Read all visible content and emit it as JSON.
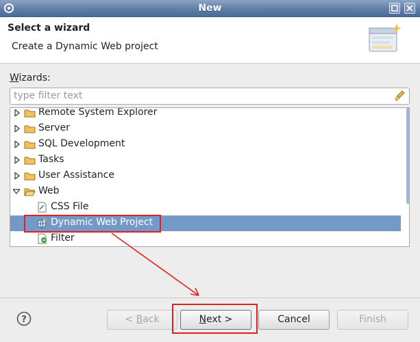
{
  "window": {
    "title": "New"
  },
  "header": {
    "title": "Select a wizard",
    "description": "Create a Dynamic Web project"
  },
  "wizards_label_prefix": "W",
  "wizards_label_rest": "izards:",
  "filter": {
    "placeholder": "type filter text"
  },
  "tree": [
    {
      "label": "Remote System Explorer",
      "type": "folder",
      "expanded": false
    },
    {
      "label": "Server",
      "type": "folder",
      "expanded": false
    },
    {
      "label": "SQL Development",
      "type": "folder",
      "expanded": false
    },
    {
      "label": "Tasks",
      "type": "folder",
      "expanded": false
    },
    {
      "label": "User Assistance",
      "type": "folder",
      "expanded": false
    },
    {
      "label": "Web",
      "type": "folder",
      "expanded": true
    },
    {
      "label": "CSS File",
      "type": "item",
      "selected": false
    },
    {
      "label": "Dynamic Web Project",
      "type": "item",
      "selected": true
    },
    {
      "label": "Filter",
      "type": "item",
      "selected": false
    }
  ],
  "buttons": {
    "back_prefix": "< ",
    "back_mnemonic": "B",
    "back_rest": "ack",
    "next_mnemonic": "N",
    "next_rest": "ext >",
    "cancel": "Cancel",
    "finish": "Finish"
  },
  "colors": {
    "selection": "#7599c6",
    "annotation": "#e02020",
    "titlebar": "#5f7fa8"
  }
}
